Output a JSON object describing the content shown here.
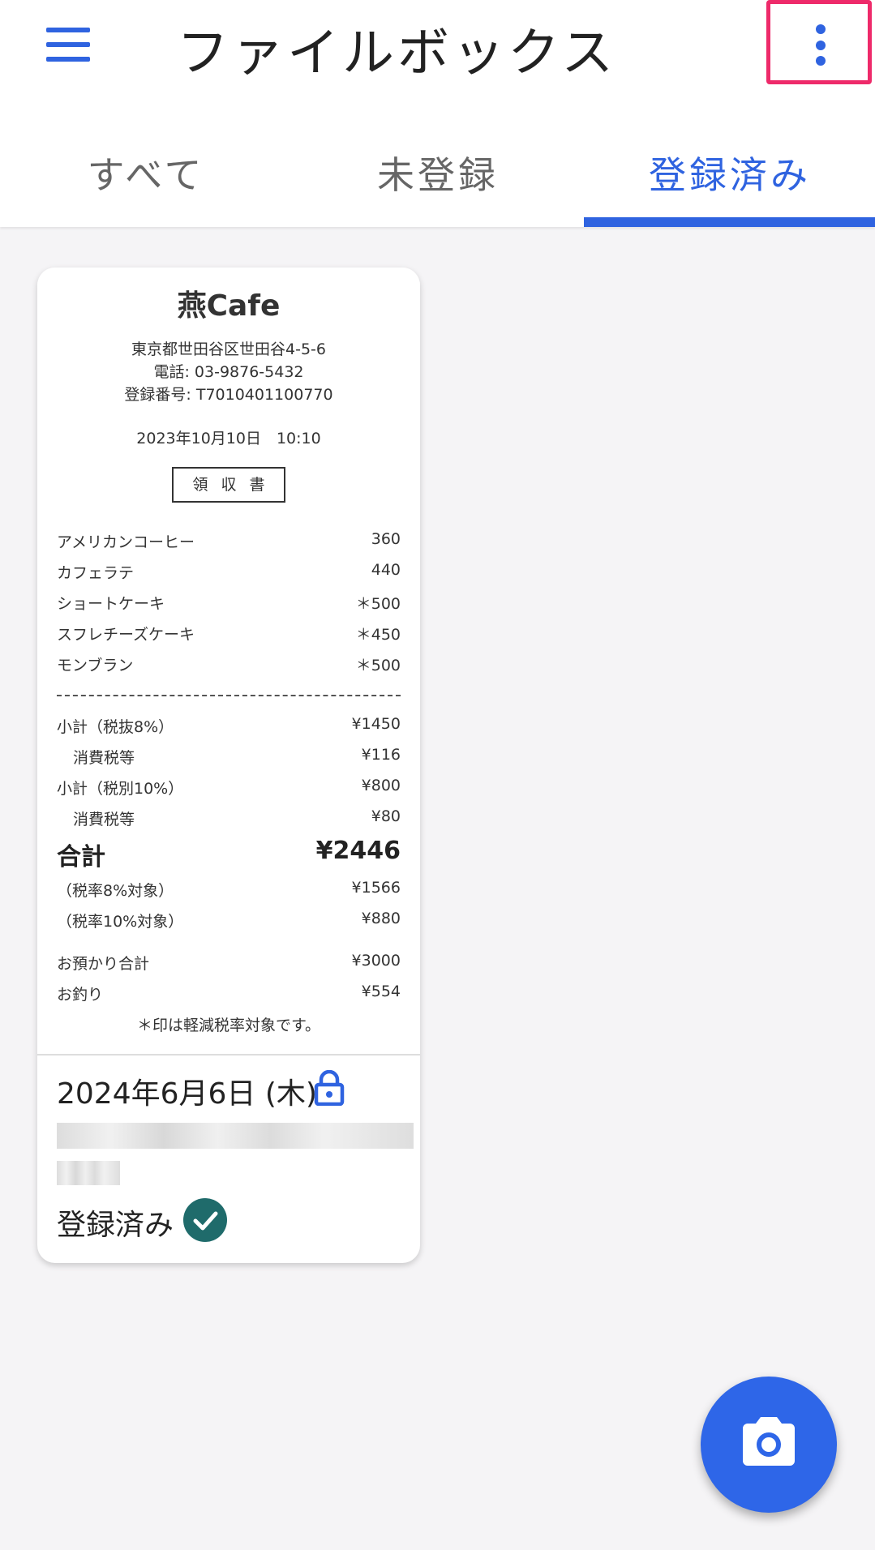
{
  "app": {
    "title": "ファイルボックス"
  },
  "tabs": [
    {
      "label": "すべて"
    },
    {
      "label": "未登録"
    },
    {
      "label": "登録済み"
    }
  ],
  "card": {
    "receipt": {
      "shop": "燕Cafe",
      "address": "東京都世田谷区世田谷4-5-6",
      "tel": "電話: 03-9876-5432",
      "reg_no": "登録番号: T7010401100770",
      "datetime": "2023年10月10日　10:10",
      "stamp": "領収書",
      "items": [
        {
          "name": "アメリカンコーヒー",
          "price": "360"
        },
        {
          "name": "カフェラテ",
          "price": "440"
        },
        {
          "name": "ショートケーキ",
          "price": "＊500"
        },
        {
          "name": "スフレチーズケーキ",
          "price": "＊450"
        },
        {
          "name": "モンブラン",
          "price": "＊500"
        }
      ],
      "summary": [
        {
          "name": "小計（税抜8%）",
          "price": "¥1450"
        },
        {
          "name": "消費税等",
          "price": "¥116"
        },
        {
          "name": "小計（税別10%）",
          "price": "¥800"
        },
        {
          "name": "消費税等",
          "price": "¥80"
        }
      ],
      "total": {
        "name": "合計",
        "price": "¥2446"
      },
      "breakdown": [
        {
          "name": "（税率8%対象）",
          "price": "¥1566"
        },
        {
          "name": "（税率10%対象）",
          "price": "¥880"
        }
      ],
      "payment": [
        {
          "name": "お預かり合計",
          "price": "¥3000"
        },
        {
          "name": "お釣り",
          "price": "¥554"
        }
      ],
      "note": "＊印は軽減税率対象です。"
    },
    "date": "2024年6月6日 (木)",
    "status": "登録済み"
  },
  "colors": {
    "accent": "#2f63e0",
    "highlight_border": "#ee2a6a",
    "status_check": "#1f6b6b",
    "fab": "#2e66e8"
  },
  "icons": {
    "menu": "menu-icon",
    "more": "more-vert-icon",
    "lock": "lock-icon",
    "check": "check-circle-icon",
    "camera": "camera-icon"
  }
}
